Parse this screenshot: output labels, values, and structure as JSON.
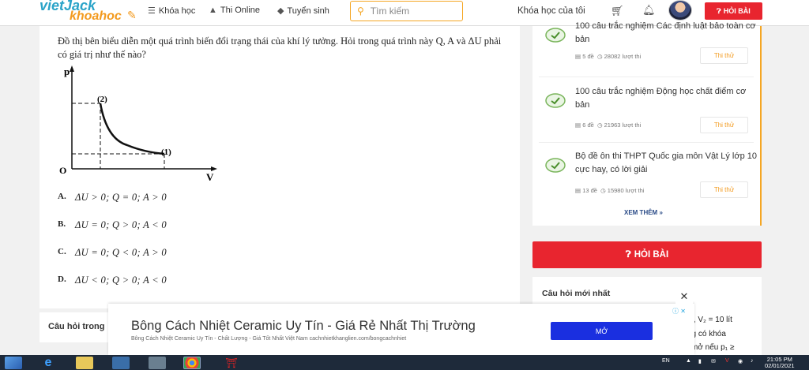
{
  "header": {
    "logo_top": "vietJack",
    "logo_bottom": "khoahoc",
    "nav": [
      {
        "icon": "menu-icon",
        "label": "Khóa học"
      },
      {
        "icon": "graduation-cap-icon",
        "label": "Thi Online"
      },
      {
        "icon": "cap-icon",
        "label": "Tuyển sinh"
      }
    ],
    "search_placeholder": "Tìm kiếm",
    "my_courses": "Khóa học của tôi",
    "ask_button": "HỎI BÀI"
  },
  "question": {
    "text": "Đồ thị bên biểu diễn một quá trình biến đổi trạng thái của khí lý tưởng. Hỏi trong quá trình này Q, A và ΔU phải có giá trị như thế nào?",
    "graph_labels": {
      "y_axis": "p",
      "x_axis": "V",
      "origin": "O",
      "point2": "(2)",
      "point1": "(1)"
    },
    "answers": [
      {
        "label": "A.",
        "expr": "ΔU > 0;  Q = 0;  A > 0"
      },
      {
        "label": "B.",
        "expr": "ΔU = 0;  Q > 0;  A < 0"
      },
      {
        "label": "C.",
        "expr": "ΔU = 0;  Q < 0;  A > 0"
      },
      {
        "label": "D.",
        "expr": "ΔU < 0;  Q > 0;  A < 0"
      }
    ]
  },
  "related": {
    "title": "Câu hỏi trong"
  },
  "sidebar": {
    "items": [
      {
        "title": "100 câu trắc nghiệm Các định luật bảo toàn cơ bản",
        "meta_docs": "5 đề",
        "meta_views": "28082 lượt thi",
        "try": "Thi thử"
      },
      {
        "title": "100 câu trắc nghiệm Động học chất điểm cơ bản",
        "meta_docs": "6 đề",
        "meta_views": "21963 lượt thi",
        "try": "Thi thử"
      },
      {
        "title": "Bộ đề ôn thi THPT Quốc gia môn Vật Lý lớp 10 cực hay, có lời giải",
        "meta_docs": "13 đề",
        "meta_views": "15980 lượt thi",
        "try": "Thi thử"
      }
    ],
    "see_more": "XEM THÊM »",
    "ask_button": "HỎI BÀI",
    "newest_title": "Câu hỏi mới nhất",
    "newest_lines": [
      "lít, V₂ = 10 lít",
      "ng có khóa",
      "ỉ mở nếu p₁ ≥"
    ]
  },
  "ad": {
    "title": "Bông Cách Nhiệt Ceramic Uy Tín - Giá Rẻ Nhất Thị Trường",
    "subtitle": "Bông Cách Nhiệt Ceramic Uy Tín - Chất Lượng - Giá Tốt Nhất Việt Nam cachnhietkhanglien.com/bongcachnhiet",
    "button": "MỞ",
    "close": "✕",
    "badge": "ⓘ ✕"
  },
  "taskbar": {
    "lang": "EN",
    "time": "21:05 PM",
    "date": "02/01/2021"
  },
  "colors": {
    "red": "#e8252f",
    "orange": "#f5a623",
    "blue": "#1a2fe0",
    "logo_blue": "#2aa3c8"
  }
}
